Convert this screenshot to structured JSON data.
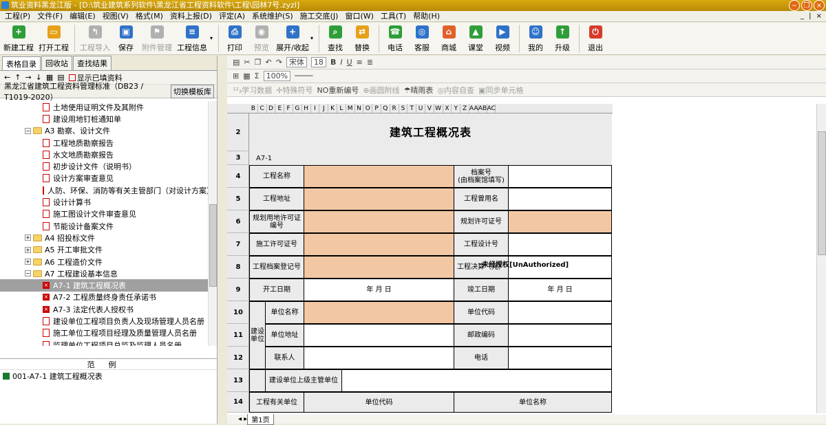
{
  "window": {
    "title": "筑业资料黑龙江版 - [D:\\筑业建筑系列软件\\黑龙江省工程资料软件\\工程\\园林7号.zyzl]"
  },
  "menu": [
    "工程(P)",
    "文件(F)",
    "编辑(E)",
    "视图(V)",
    "格式(M)",
    "资料上报(D)",
    "评定(A)",
    "系统维护(S)",
    "施工交底(J)",
    "窗口(W)",
    "工具(T)",
    "帮助(H)"
  ],
  "menu_right": "_ | ×",
  "toolbar": [
    {
      "label": "新建工程",
      "icon": "new-project-icon",
      "color": "#2f9e3a",
      "glyph": "+",
      "enabled": true
    },
    {
      "label": "打开工程",
      "icon": "open-folder-icon",
      "color": "#e6a11a",
      "glyph": "▭",
      "enabled": true
    },
    {
      "label": "工程导入",
      "icon": "import-icon",
      "color": "#b0b0b0",
      "glyph": "↰",
      "enabled": false
    },
    {
      "label": "保存",
      "icon": "save-icon",
      "color": "#2f72c8",
      "glyph": "▣",
      "enabled": true
    },
    {
      "label": "附件管理",
      "icon": "attachment-icon",
      "color": "#b0b0b0",
      "glyph": "⚑",
      "enabled": false
    },
    {
      "label": "工程信息",
      "icon": "project-info-icon",
      "color": "#2f72c8",
      "glyph": "≡",
      "enabled": true
    },
    {
      "label": "打印",
      "icon": "print-icon",
      "color": "#2f72c8",
      "glyph": "⎙",
      "enabled": true
    },
    {
      "label": "预览",
      "icon": "preview-icon",
      "color": "#b0b0b0",
      "glyph": "◉",
      "enabled": false
    },
    {
      "label": "展开/收起",
      "icon": "expand-collapse-icon",
      "color": "#2f72c8",
      "glyph": "+",
      "enabled": true
    },
    {
      "label": "查找",
      "icon": "search-icon",
      "color": "#2f9e3a",
      "glyph": "⌕",
      "enabled": true
    },
    {
      "label": "替换",
      "icon": "replace-icon",
      "color": "#e6a11a",
      "glyph": "⇄",
      "enabled": true
    },
    {
      "label": "电话",
      "icon": "phone-icon",
      "color": "#2f9e3a",
      "glyph": "☎",
      "enabled": true
    },
    {
      "label": "客服",
      "icon": "service-icon",
      "color": "#2f72c8",
      "glyph": "◎",
      "enabled": true
    },
    {
      "label": "商城",
      "icon": "shop-icon",
      "color": "#e0602a",
      "glyph": "⌂",
      "enabled": true
    },
    {
      "label": "课堂",
      "icon": "classroom-icon",
      "color": "#2f9e3a",
      "glyph": "▲",
      "enabled": true
    },
    {
      "label": "视频",
      "icon": "video-icon",
      "color": "#2f72c8",
      "glyph": "▶",
      "enabled": true
    },
    {
      "label": "我的",
      "icon": "user-icon",
      "color": "#2f72c8",
      "glyph": "☺",
      "enabled": true
    },
    {
      "label": "升级",
      "icon": "upgrade-icon",
      "color": "#2f9e3a",
      "glyph": "↑",
      "enabled": true
    },
    {
      "label": "退出",
      "icon": "exit-icon",
      "color": "#d63a2a",
      "glyph": "⏻",
      "enabled": true
    }
  ],
  "left": {
    "tabs": [
      "表格目录",
      "回收站",
      "查找结果"
    ],
    "show_filled": "显示已填资料",
    "standard": "黑龙江省建筑工程资料管理标准（DB23 / T1019-2020）",
    "switch_template": "切换模板库",
    "tree": [
      {
        "label": "土地使用证明文件及其附件",
        "level": 3,
        "type": "doc"
      },
      {
        "label": "建设用地钉桩通知单",
        "level": 3,
        "type": "doc"
      },
      {
        "label": "A3 勘察、设计文件",
        "level": 2,
        "type": "folder",
        "exp": "−"
      },
      {
        "label": "工程地质勘察报告",
        "level": 3,
        "type": "doc"
      },
      {
        "label": "水文地质勘察报告",
        "level": 3,
        "type": "doc"
      },
      {
        "label": "初步设计文件（说明书）",
        "level": 3,
        "type": "doc"
      },
      {
        "label": "设计方案审查意见",
        "level": 3,
        "type": "doc"
      },
      {
        "label": "人防、环保、消防等有关主管部门（对设计方案）审",
        "level": 3,
        "type": "doc"
      },
      {
        "label": "设计计算书",
        "level": 3,
        "type": "doc"
      },
      {
        "label": "施工图设计文件审查意见",
        "level": 3,
        "type": "doc"
      },
      {
        "label": "节能设计备案文件",
        "level": 3,
        "type": "doc"
      },
      {
        "label": "A4 招投标文件",
        "level": 2,
        "type": "folder",
        "exp": "+"
      },
      {
        "label": "A5 开工审批文件",
        "level": 2,
        "type": "folder",
        "exp": "+"
      },
      {
        "label": "A6 工程造价文件",
        "level": 2,
        "type": "folder",
        "exp": "+"
      },
      {
        "label": "A7 工程建设基本信息",
        "level": 2,
        "type": "folder",
        "exp": "−"
      },
      {
        "label": "A7-1 建筑工程概况表",
        "level": 3,
        "type": "docx",
        "selected": true
      },
      {
        "label": "A7-2 工程质量终身责任承诺书",
        "level": 3,
        "type": "docx"
      },
      {
        "label": "A7-3 法定代表人授权书",
        "level": 3,
        "type": "docx"
      },
      {
        "label": "建设单位工程项目负责人及现场管理人员名册",
        "level": 3,
        "type": "doc"
      },
      {
        "label": "施工单位工程项目经理及质量管理人员名册",
        "level": 3,
        "type": "doc"
      },
      {
        "label": "监理单位工程项目总监及监理人员名册",
        "level": 3,
        "type": "doc"
      }
    ],
    "sample_header": "范例",
    "sample_item": "001-A7-1 建筑工程概况表"
  },
  "format": {
    "font": "宋体",
    "size": "18",
    "zoom": "100%",
    "row3": [
      "¹²₃学习数据",
      "✢特殊符号",
      "NO重新编号",
      "⊕画圆附线",
      "☂晴雨表",
      "◎内容自查",
      "▣同步单元格"
    ]
  },
  "columns": [
    "B",
    "C",
    "D",
    "E",
    "F",
    "G",
    "H",
    "I",
    "J",
    "K",
    "L",
    "M",
    "N",
    "O",
    "P",
    "Q",
    "R",
    "S",
    "T",
    "U",
    "V",
    "W",
    "X",
    "Y",
    "Z",
    "AA",
    "AB",
    "AC"
  ],
  "sheet": {
    "title": "建筑工程概况表",
    "code": "A7-1",
    "rows": [
      "2",
      "3",
      "4",
      "5",
      "6",
      "7",
      "8",
      "9",
      "10",
      "11",
      "12",
      "13",
      "14"
    ],
    "labels": {
      "name": "工程名称",
      "archive": "档案号\n(由档案馆填写)",
      "address": "工程地址",
      "former_name": "工程曾用名",
      "land_permit": "规划用地许可证编号",
      "plan_permit": "规划许可证号",
      "construct_permit": "施工许可证号",
      "design_no": "工程设计号",
      "archive_reg": "工程档案登记号",
      "final_acc": "工程决算（元）",
      "start": "开工日期",
      "date_tpl": "年  月  日",
      "end": "竣工日期",
      "date_tpl2": "年  月  日",
      "build_unit": "建设单位",
      "unit_name": "单位名称",
      "unit_code": "单位代码",
      "unit_addr": "单位地址",
      "postcode": "邮政编码",
      "contact": "联系人",
      "phone": "电话",
      "superior": "建设单位上级主管单位",
      "related": "工程有关单位",
      "rel_code": "单位代码",
      "rel_name": "单位名称"
    },
    "watermark": "未经授权[UnAuthorized]",
    "sheet_tab": "第1页"
  }
}
